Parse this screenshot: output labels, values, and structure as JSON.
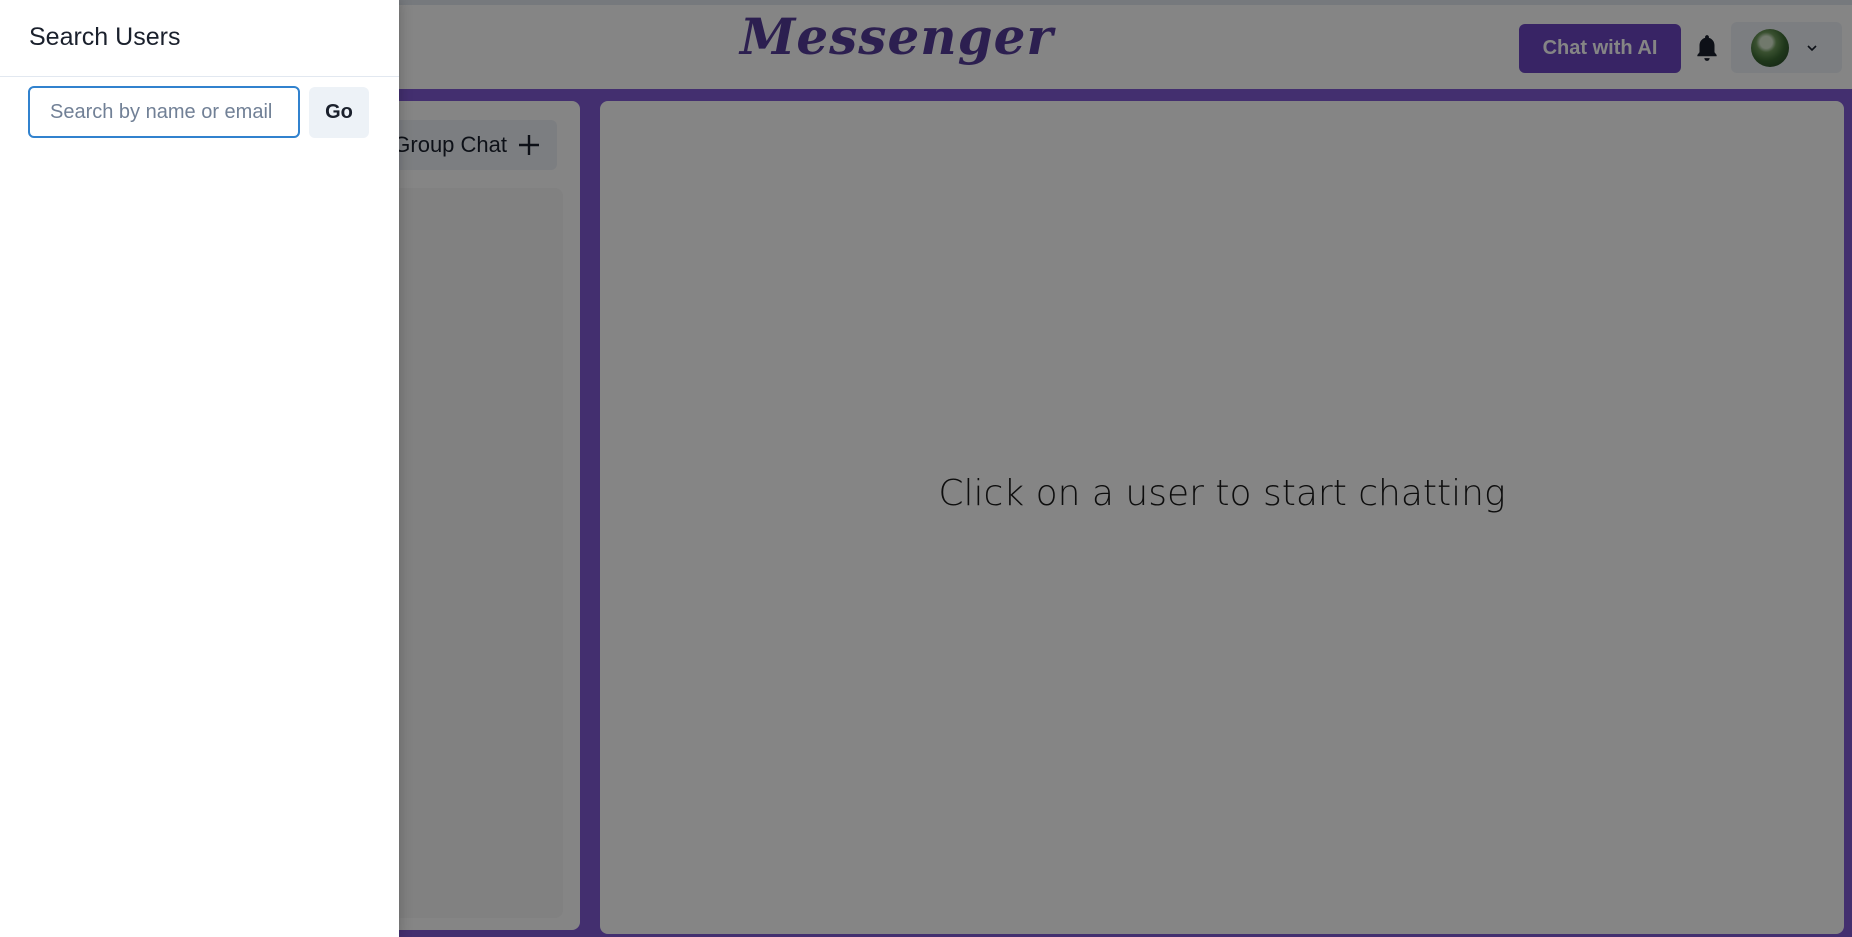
{
  "header": {
    "logo": "Messenger",
    "ai_button": "Chat with AI",
    "bell_icon": "bell-icon",
    "profile_chevron_icon": "chevron-down-icon"
  },
  "chat_list": {
    "new_group_button": "New Group Chat",
    "plus_icon": "plus-icon"
  },
  "chat_box": {
    "empty_message": "Click on a user to start chatting"
  },
  "drawer": {
    "title": "Search Users",
    "search_placeholder": "Search by name or email",
    "search_value": "",
    "go_button": "Go"
  },
  "colors": {
    "accent": "#805ad5",
    "button_primary": "#6b46c1",
    "logo": "#553c9a",
    "input_focus": "#3182ce"
  }
}
